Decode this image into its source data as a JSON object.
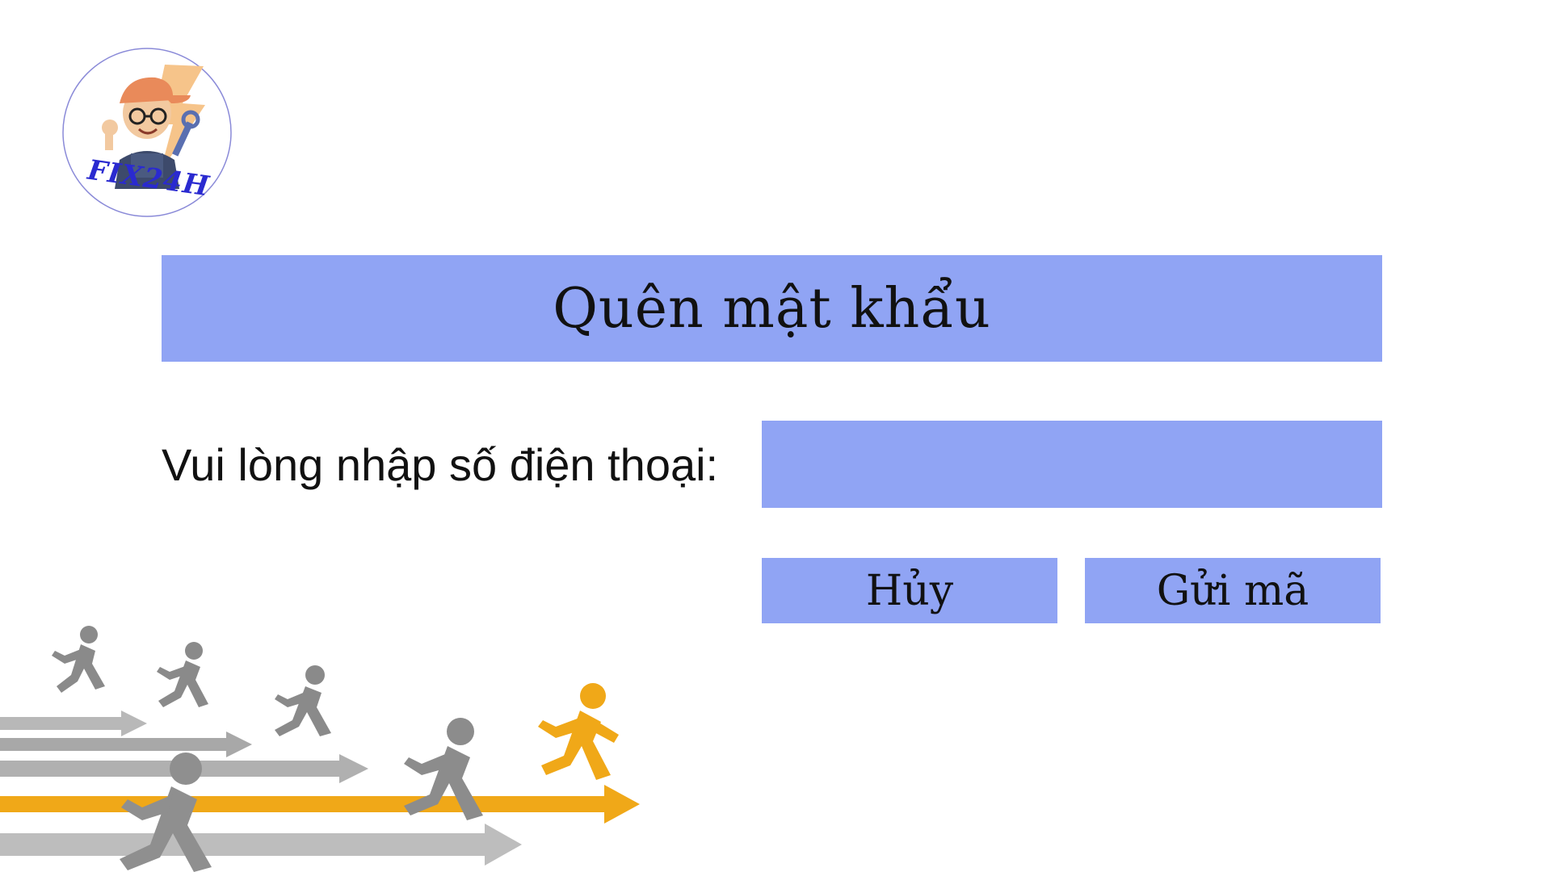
{
  "logo": {
    "text": "FIX24H",
    "icon": "mechanic-mascot-icon"
  },
  "form": {
    "title": "Quên mật khẩu",
    "phone_label": "Vui lòng nhập số điện thoại:",
    "phone_value": "",
    "cancel_label": "Hủy",
    "send_label": "Gửi mã"
  },
  "illustration": {
    "icon": "runners-race-illustration"
  },
  "colors": {
    "accent": "#90a4f4",
    "leader": "#f0a818",
    "runners": "#8a8a8a",
    "logo_text": "#2a2ad0"
  }
}
